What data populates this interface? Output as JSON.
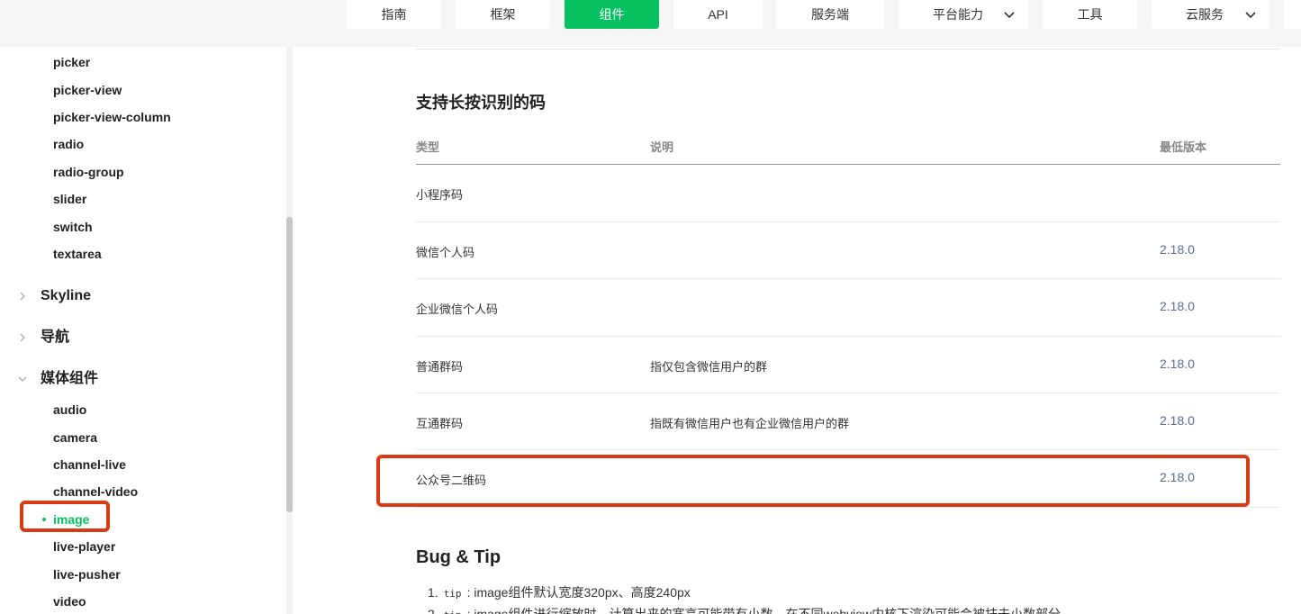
{
  "nav": {
    "items": [
      {
        "label": "指南"
      },
      {
        "label": "框架"
      },
      {
        "label": "组件",
        "active": true
      },
      {
        "label": "API"
      },
      {
        "label": "服务端"
      },
      {
        "label": "平台能力",
        "dropdown": true
      },
      {
        "label": "工具"
      },
      {
        "label": "云服务",
        "dropdown": true
      }
    ]
  },
  "sidebar": {
    "top_items": [
      "picker",
      "picker-view",
      "picker-view-column",
      "radio",
      "radio-group",
      "slider",
      "switch",
      "textarea"
    ],
    "groups": [
      {
        "label": "Skyline",
        "expanded": false
      },
      {
        "label": "导航",
        "expanded": false
      },
      {
        "label": "媒体组件",
        "expanded": true
      }
    ],
    "media_items": [
      "audio",
      "camera",
      "channel-live",
      "channel-video",
      "image",
      "live-player",
      "live-pusher",
      "video"
    ],
    "active_item": "image"
  },
  "main": {
    "section_title": "支持长按识别的码",
    "table": {
      "headers": [
        "类型",
        "说明",
        "最低版本"
      ],
      "rows": [
        {
          "type": "小程序码",
          "desc": "",
          "version": ""
        },
        {
          "type": "微信个人码",
          "desc": "",
          "version": "2.18.0"
        },
        {
          "type": "企业微信个人码",
          "desc": "",
          "version": "2.18.0"
        },
        {
          "type": "普通群码",
          "desc": "指仅包含微信用户的群",
          "version": "2.18.0"
        },
        {
          "type": "互通群码",
          "desc": "指既有微信用户也有企业微信用户的群",
          "version": "2.18.0"
        },
        {
          "type": "公众号二维码",
          "desc": "",
          "version": "2.18.0"
        }
      ]
    },
    "bug_title": "Bug & Tip",
    "tips": [
      {
        "num": "1.",
        "code": "tip",
        "text": ": image组件默认宽度320px、高度240px"
      },
      {
        "num": "2.",
        "code": "tip",
        "text": ": image组件进行缩放时，计算出来的宽高可能带有小数，在不同webview内核下渲染可能会被抹去小数部分"
      }
    ]
  },
  "colors": {
    "accent": "#07c160",
    "version": "#576b95",
    "highlight": "#d93b14"
  }
}
